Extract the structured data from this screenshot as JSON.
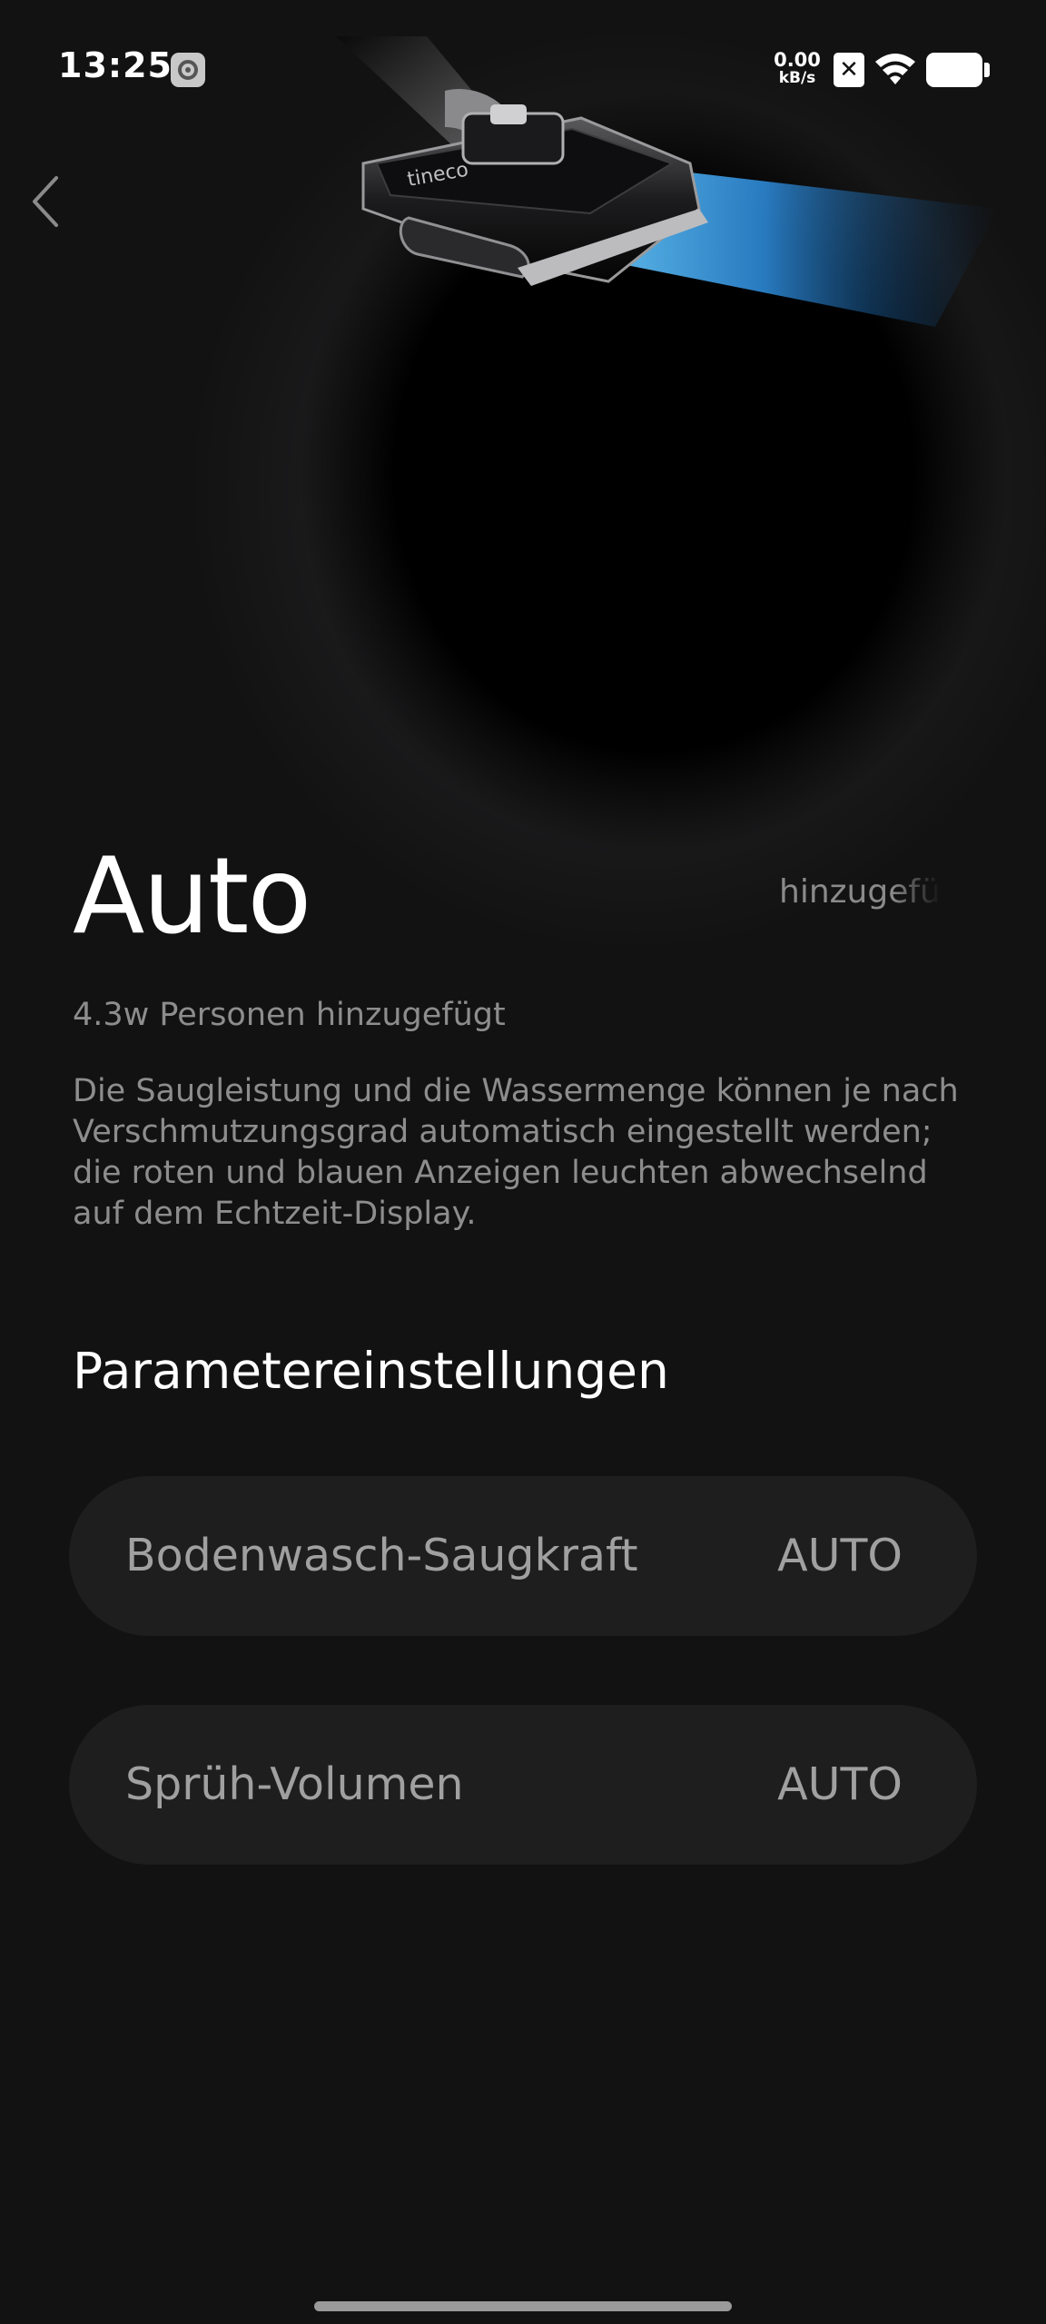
{
  "status_bar": {
    "time": "13:25",
    "net_speed_value": "0.00",
    "net_speed_unit": "kB/s",
    "battery_level": 0.9
  },
  "header": {
    "back_icon": "chevron-left-icon"
  },
  "hero": {
    "image": "wet-dry-vacuum-floor-head",
    "brand_text": "tineco",
    "scrolling_text": "hinzugefügt"
  },
  "mode": {
    "title": "Auto",
    "users_added": "4.3w Personen hinzugefügt",
    "description": "Die Saugleistung und die Wassermenge können je nach Verschmutzungsgrad automatisch eingestellt werden; die roten und blauen Anzeigen leuchten abwechselnd auf dem Echtzeit-Display."
  },
  "parameters": {
    "section_title": "Parametereinstellungen",
    "items": [
      {
        "label": "Bodenwasch-Saugkraft",
        "value": "AUTO"
      },
      {
        "label": "Sprüh-Volumen",
        "value": "AUTO"
      }
    ]
  },
  "colors": {
    "background": "#121212",
    "card": "#1e1e1e",
    "accent_blue": "#3aa8ff",
    "text_secondary": "#8d8d8d"
  }
}
